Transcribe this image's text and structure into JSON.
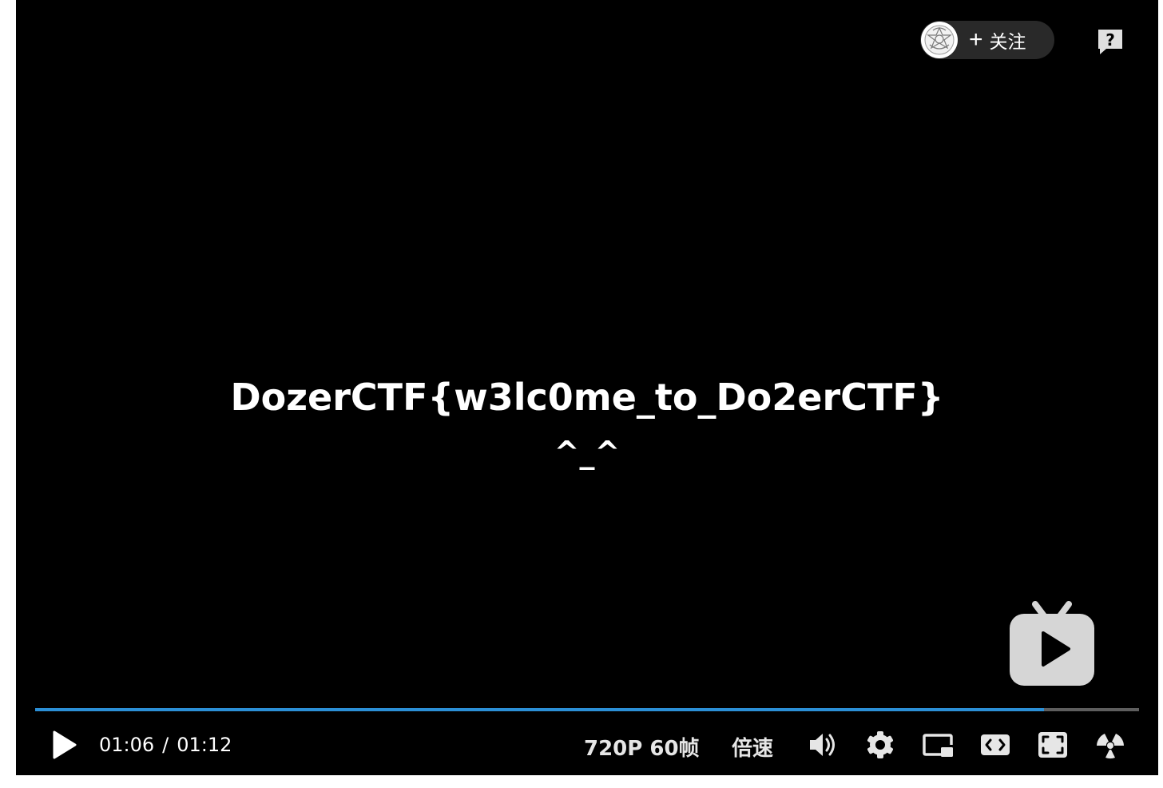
{
  "follow": {
    "plus": "+",
    "label": "关注"
  },
  "help": {
    "symbol": "?"
  },
  "video": {
    "flag_text": "DozerCTF{w3lc0me_to_Do2erCTF}",
    "emoticon": "^_^"
  },
  "progress": {
    "played_fraction": 0.914,
    "fill_color": "#2b8fd6"
  },
  "controls": {
    "current_time": "01:06",
    "separator": "/",
    "duration": "01:12",
    "quality": "720P 60帧",
    "speed": "倍速"
  },
  "icons": [
    "play-icon",
    "volume-icon",
    "settings-icon",
    "picture-in-picture-icon",
    "widescreen-icon",
    "fullscreen-icon",
    "radiation-icon",
    "bilibili-tv-logo",
    "help-icon"
  ]
}
